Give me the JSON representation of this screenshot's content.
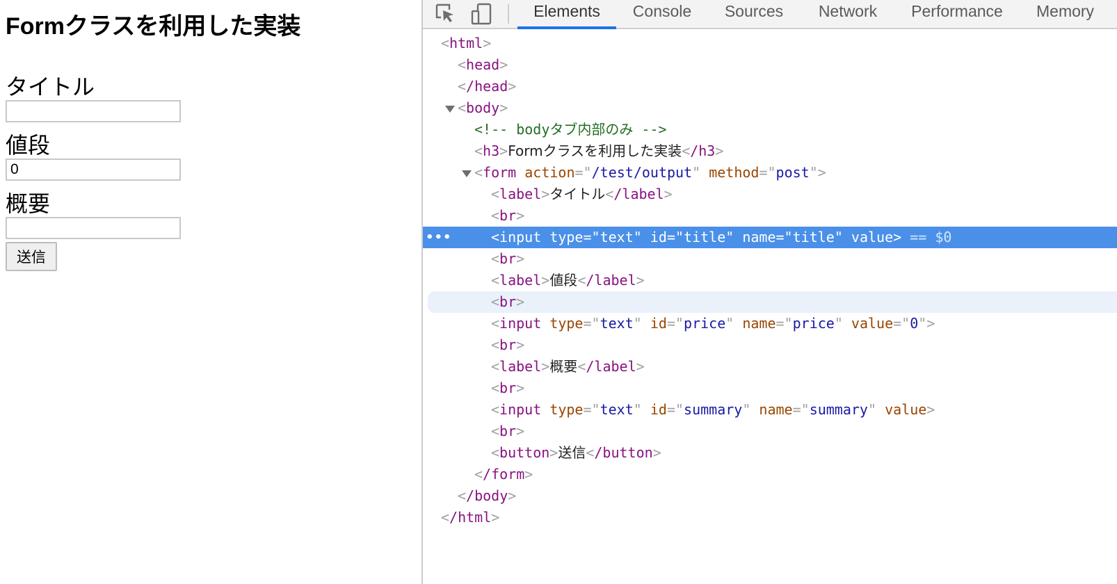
{
  "page": {
    "heading": "Formクラスを利用した実装",
    "title_label": "タイトル",
    "title_value": "",
    "price_label": "値段",
    "price_value": "0",
    "summary_label": "概要",
    "summary_value": "",
    "submit_label": "送信"
  },
  "devtools": {
    "tabs": [
      "Elements",
      "Console",
      "Sources",
      "Network",
      "Performance",
      "Memory"
    ],
    "active_tab": "Elements",
    "selected_marker": "== $0",
    "tree": {
      "html_open": "html",
      "head_open": "head",
      "head_close": "/head",
      "body_open": "body",
      "comment": "<!-- bodyタブ内部のみ -->",
      "h3_tag": "h3",
      "h3_text": "Formクラスを利用した実装",
      "h3_close": "/h3",
      "form_tag": "form",
      "form_action_attr": "action",
      "form_action_val": "/test/output",
      "form_method_attr": "method",
      "form_method_val": "post",
      "label_tag": "label",
      "label_close": "/label",
      "label1_text": "タイトル",
      "label2_text": "値段",
      "label3_text": "概要",
      "br_tag": "br",
      "input_tag": "input",
      "type_attr": "type",
      "id_attr": "id",
      "name_attr": "name",
      "value_attr": "value",
      "text_val": "text",
      "title_val": "title",
      "price_val": "price",
      "zero_val": "0",
      "summary_val": "summary",
      "button_tag": "button",
      "button_text": "送信",
      "button_close": "/button",
      "form_close": "/form",
      "body_close": "/body",
      "html_close": "/html"
    }
  },
  "colors": {
    "selection": "#4a90e8",
    "tab_underline": "#1a73e8",
    "tag": "#881280",
    "attr_name": "#994500",
    "attr_value": "#1a1aa6",
    "comment": "#236e25"
  }
}
